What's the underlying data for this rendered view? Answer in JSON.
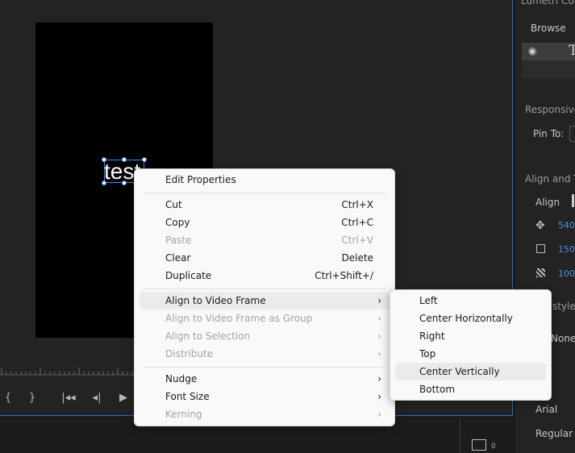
{
  "monitor": {
    "text_layer": "test",
    "transport": [
      "{",
      "}",
      "|◂◂",
      "◂|",
      "▶"
    ]
  },
  "right_panel": {
    "panel_title": "Lumetri Color",
    "browse_tab": "Browse",
    "responsive": "Responsive D",
    "pin_to": "Pin To:",
    "align_title": "Align and Tra",
    "align_label": "Align",
    "position_value": "540",
    "scale_value": "150",
    "opacity_value": "100",
    "style_label": "style",
    "none_label": "None",
    "font_family": "Arial",
    "font_style": "Regular",
    "timecode_hint": "0"
  },
  "context_menu": {
    "items": [
      {
        "label": "Edit Properties",
        "shortcut": "",
        "disabled": false,
        "submenu": false
      },
      {
        "label": "Cut",
        "shortcut": "Ctrl+X",
        "disabled": false,
        "submenu": false
      },
      {
        "label": "Copy",
        "shortcut": "Ctrl+C",
        "disabled": false,
        "submenu": false
      },
      {
        "label": "Paste",
        "shortcut": "Ctrl+V",
        "disabled": true,
        "submenu": false
      },
      {
        "label": "Clear",
        "shortcut": "Delete",
        "disabled": false,
        "submenu": false
      },
      {
        "label": "Duplicate",
        "shortcut": "Ctrl+Shift+/",
        "disabled": false,
        "submenu": false
      },
      {
        "label": "Align to Video Frame",
        "shortcut": "",
        "disabled": false,
        "submenu": true
      },
      {
        "label": "Align to Video Frame as Group",
        "shortcut": "",
        "disabled": true,
        "submenu": true
      },
      {
        "label": "Align to Selection",
        "shortcut": "",
        "disabled": true,
        "submenu": true
      },
      {
        "label": "Distribute",
        "shortcut": "",
        "disabled": true,
        "submenu": true
      },
      {
        "label": "Nudge",
        "shortcut": "",
        "disabled": false,
        "submenu": true
      },
      {
        "label": "Font Size",
        "shortcut": "",
        "disabled": false,
        "submenu": true
      },
      {
        "label": "Kerning",
        "shortcut": "",
        "disabled": true,
        "submenu": true
      }
    ],
    "submenu_arrow": "›"
  },
  "align_submenu": {
    "items": [
      "Left",
      "Center Horizontally",
      "Right",
      "Top",
      "Center Vertically",
      "Bottom"
    ]
  }
}
